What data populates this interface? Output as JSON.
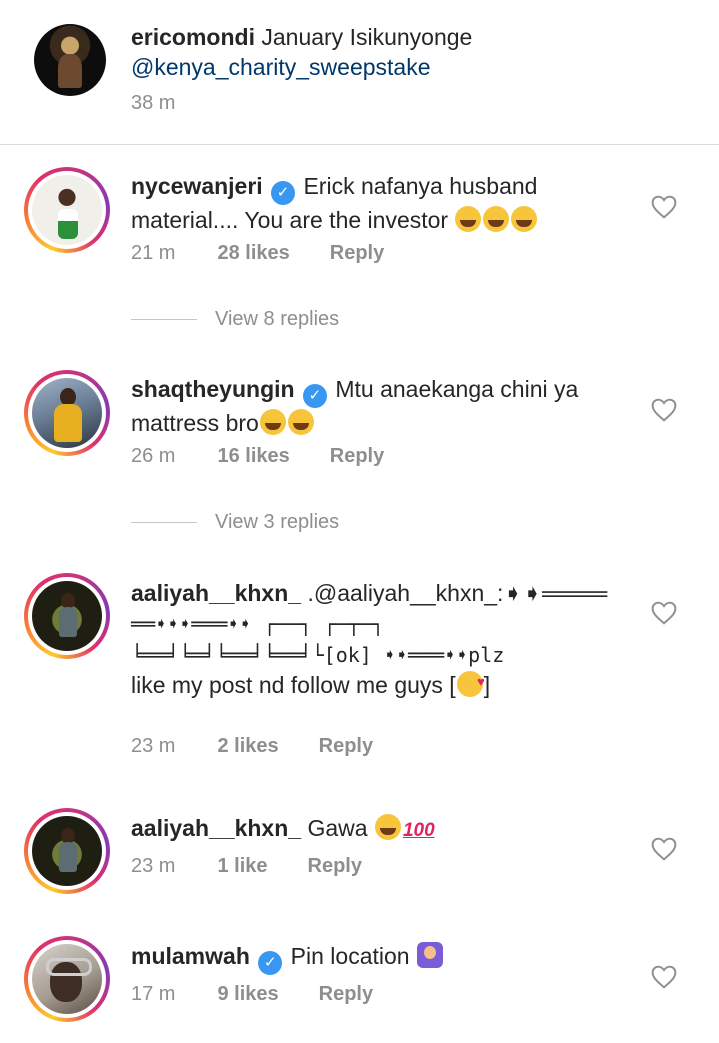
{
  "caption": {
    "username": "ericomondi",
    "text": "January Isikunyonge",
    "mention": "@kenya_charity_sweepstake",
    "time": "38 m"
  },
  "comments": [
    {
      "username": "nycewanjeri",
      "verified": true,
      "text_line1": "Erick nafanya husband",
      "text_line2": "material.... You are the investor",
      "emojis": [
        "rolling-on-floor-laughing",
        "rolling-on-floor-laughing",
        "rolling-on-floor-laughing"
      ],
      "time": "21 m",
      "likes": "28 likes",
      "reply": "Reply",
      "view_replies": "View 8 replies"
    },
    {
      "username": "shaqtheyungin",
      "verified": true,
      "text_line1": "Mtu anaekanga chini ya",
      "text_line2": "mattress bro",
      "emojis": [
        "face-with-tears-of-joy",
        "face-with-tears-of-joy"
      ],
      "time": "26 m",
      "likes": "16 likes",
      "reply": "Reply",
      "view_replies": "View 3 replies"
    },
    {
      "username": "aaliyah__khxn_",
      "verified": false,
      "text_line1": ".@aaliyah__khxn_:➧➧════",
      "text_line2": "══➧➧➧═══➧➧ ┌──┐ ┌─┬─┐",
      "text_line3": "╘══╛╘═╛╘══╛╘══╛└[ok] ➧➧═══➧➧plz",
      "text_line4": "like my post nd follow me guys [",
      "text_line4_end": "]",
      "emojis": [
        "face-blowing-a-kiss"
      ],
      "time": "23 m",
      "likes": "2 likes",
      "reply": "Reply"
    },
    {
      "username": "aaliyah__khxn_",
      "verified": false,
      "text_line1": "Gawa",
      "emojis": [
        "face-with-tears-of-joy",
        "hundred-points"
      ],
      "hundred": "100",
      "time": "23 m",
      "likes": "1 like",
      "reply": "Reply"
    },
    {
      "username": "mulamwah",
      "verified": true,
      "text_line1": "Pin location",
      "emojis": [
        "woman-gesturing-no"
      ],
      "time": "17 m",
      "likes": "9 likes",
      "reply": "Reply"
    }
  ],
  "icons": {
    "verified_badge": "verified-badge-icon",
    "like": "heart-outline-icon"
  },
  "colors": {
    "text": "#262626",
    "secondary": "#8e8e8e",
    "mention": "#00376b",
    "verified": "#3897f0"
  }
}
